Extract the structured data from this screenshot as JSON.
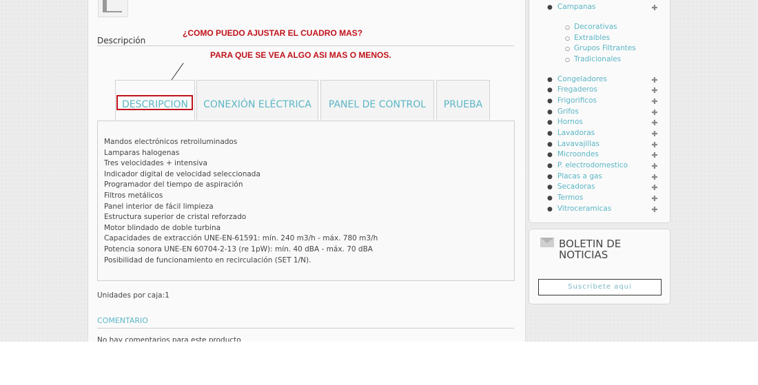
{
  "main": {
    "section_title": "Descripción",
    "annotation_1": "¿COMO PUEDO AJUSTAR EL CUADRO MAS?",
    "annotation_2": "PARA QUE SE VEA ALGO ASI MAS O MENOS.",
    "tabs": [
      {
        "label": "DESCRIPCION"
      },
      {
        "label": "CONEXIÓN ELÉCTRICA"
      },
      {
        "label": "PANEL DE CONTROL"
      },
      {
        "label": "PRUEBA"
      }
    ],
    "features": [
      "Mandos electrónicos retroiluminados",
      "Lamparas halogenas",
      "Tres velocidades + intensiva",
      "Indicador digital de velocidad seleccionada",
      "Programador del tiempo de aspiración",
      "Filtros metálicos",
      "Panel interior de fácil limpieza",
      "Estructura superior de cristal reforzado",
      "Motor blindado de doble turbina",
      "Capacidades de extracción UNE-EN-61591: mín. 240 m3/h - máx. 780 m3/h",
      "Potencia sonora UNE-EN 60704-2-13 (re 1pW): mín. 40 dBA - máx. 70 dBA",
      "Posibilidad de funcionamiento en recirculación (SET 1/N)."
    ],
    "units": "Unidades por caja:1",
    "comment_title": "COMENTARIO",
    "comment_text": "No hay comentarios para este producto"
  },
  "sidebar": {
    "top_category": "Campanas",
    "subcategories": [
      "Decorativas",
      "Extraibles",
      "Grupos Filtrantes",
      "Tradicionales"
    ],
    "categories": [
      "Congeladores",
      "Fregaderos",
      "Frigorificos",
      "Grifos",
      "Hornos",
      "Lavadoras",
      "Lavavajillas",
      "Microondes",
      "P. electrodomestico",
      "Placas a gas",
      "Secadoras",
      "Termos",
      "Vitroceramicas"
    ],
    "expand_glyph": "✚"
  },
  "newsletter": {
    "title": "BOLETIN DE NOTICIAS",
    "button": "Suscribete aqui"
  },
  "colors": {
    "accent": "#5bb6c5",
    "annotation": "#c0111a"
  }
}
